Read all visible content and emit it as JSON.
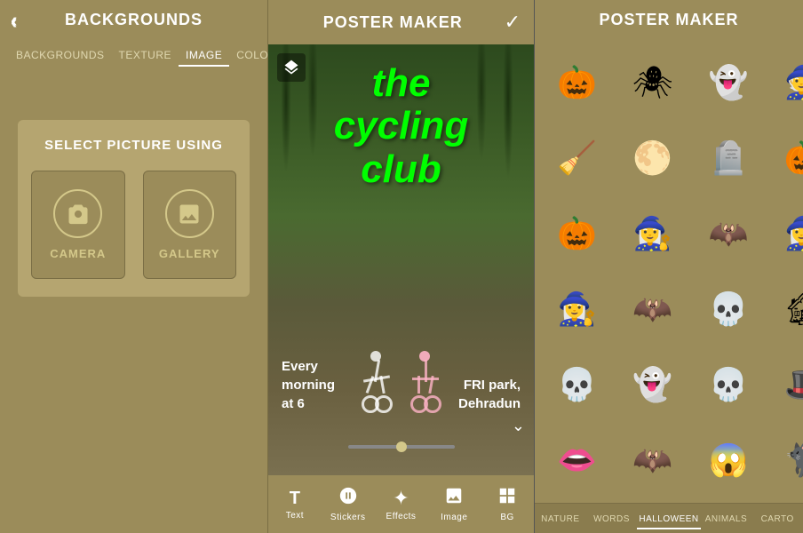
{
  "panel1": {
    "title": "BACKGROUNDS",
    "back_icon": "‹",
    "tabs": [
      {
        "label": "BACKGROUNDS",
        "active": false
      },
      {
        "label": "TEXTURE",
        "active": false
      },
      {
        "label": "IMAGE",
        "active": true
      },
      {
        "label": "COLOR",
        "active": false
      }
    ],
    "select_label": "SELECT PICTURE USING",
    "camera_label": "CAMERA",
    "gallery_label": "GALLERY"
  },
  "panel2": {
    "title": "POSTER MAKER",
    "back_icon": "‹",
    "check_icon": "✓",
    "poster_text_line1": "the",
    "poster_text_line2": "cycling",
    "poster_text_line3": "club",
    "bottom_left_line1": "Every",
    "bottom_left_line2": "morning",
    "bottom_left_line3": "at 6",
    "bottom_right_line1": "FRI park,",
    "bottom_right_line2": "Dehradun",
    "toolbar": [
      {
        "label": "Text",
        "icon": "T"
      },
      {
        "label": "Stickers",
        "icon": "⊘"
      },
      {
        "label": "Effects",
        "icon": "✦"
      },
      {
        "label": "Image",
        "icon": "⬜"
      },
      {
        "label": "BG",
        "icon": "▣"
      }
    ]
  },
  "panel3": {
    "title": "POSTER MAKER",
    "back_icon": "‹",
    "stickers": [
      {
        "emoji": "🎃",
        "name": "pumpkin"
      },
      {
        "emoji": "🕷",
        "name": "spider"
      },
      {
        "emoji": "👻",
        "name": "ghost"
      },
      {
        "emoji": "🧙",
        "name": "witch-hat"
      },
      {
        "emoji": "🧹",
        "name": "broom"
      },
      {
        "emoji": "🌕",
        "name": "moon"
      },
      {
        "emoji": "🪦",
        "name": "gravestone"
      },
      {
        "emoji": "🎃",
        "name": "pumpkin2"
      },
      {
        "emoji": "🎃",
        "name": "pumpkins"
      },
      {
        "emoji": "🧙‍♀️",
        "name": "witch"
      },
      {
        "emoji": "🦇",
        "name": "bat-moon"
      },
      {
        "emoji": "🧙‍♀️",
        "name": "witch2"
      },
      {
        "emoji": "🧙‍♀️",
        "name": "witch3"
      },
      {
        "emoji": "🦇",
        "name": "bat"
      },
      {
        "emoji": "💀",
        "name": "halloween-text"
      },
      {
        "emoji": "🏚",
        "name": "haunted-house"
      },
      {
        "emoji": "💀",
        "name": "skull"
      },
      {
        "emoji": "👻",
        "name": "ghosts"
      },
      {
        "emoji": "💀",
        "name": "reaper"
      },
      {
        "emoji": "🎩",
        "name": "hat"
      },
      {
        "emoji": "👄",
        "name": "lips"
      },
      {
        "emoji": "🦇",
        "name": "bat2"
      },
      {
        "emoji": "😱",
        "name": "scream"
      },
      {
        "emoji": "🐈‍⬛",
        "name": "black-cat"
      }
    ],
    "sticker_tabs": [
      {
        "label": "NATURE",
        "active": false
      },
      {
        "label": "WORDS",
        "active": false
      },
      {
        "label": "HALLOWEEN",
        "active": true
      },
      {
        "label": "ANIMALS",
        "active": false
      },
      {
        "label": "CARTO",
        "active": false
      }
    ]
  }
}
